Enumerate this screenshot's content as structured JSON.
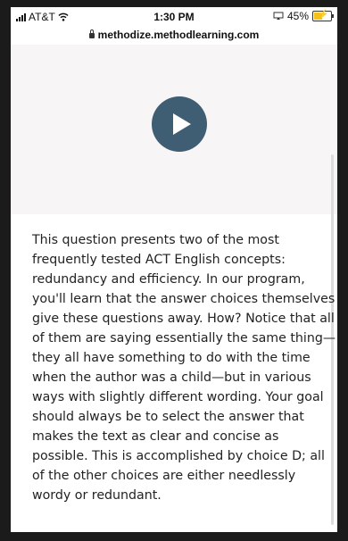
{
  "status_bar": {
    "carrier": "AT&T",
    "time": "1:30 PM",
    "battery": "45%"
  },
  "browser": {
    "url": "methodize.methodlearning.com"
  },
  "icons": {
    "wifi": "wifi-icon",
    "lock": "lock-icon",
    "play": "play-icon",
    "battery": "battery-charging-icon",
    "screen_mirror": "screen-mirror-icon"
  },
  "colors": {
    "play_button": "#3f5d73",
    "battery_fill": "#f2c21b"
  },
  "explanation": {
    "lines": [
      "This question presents two of the most",
      "frequently tested ACT English concepts:",
      "redundancy and efficiency. In our program,",
      "you'll learn that the answer choices themselves",
      "give these questions away. How? Notice that all",
      "of them are saying essentially the same thing—",
      "they all have something to do with the time",
      "when the author was a child—but in various",
      "ways with slightly different wording. Your goal",
      "should always be to select the answer that",
      "makes the text as clear and concise as",
      "possible. This is accomplished by choice D; all",
      "of the other choices are either needlessly",
      "wordy or redundant."
    ]
  }
}
